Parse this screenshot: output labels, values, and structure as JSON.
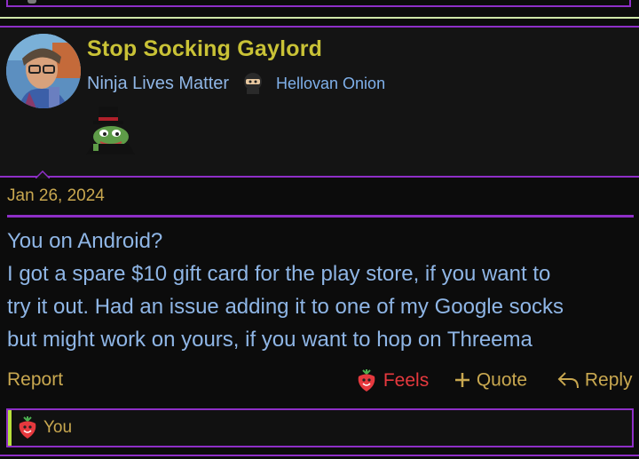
{
  "post": {
    "username": "Stop Socking Gaylord",
    "user_title": "Ninja Lives Matter",
    "user_banner": "Hellovan Onion",
    "date": "Jan 26, 2024",
    "message_lines": [
      "You on Android?",
      "I got a spare $10 gift card for the play store, if you want to",
      "try it out. Had an issue adding it to one of my Google socks",
      "but might work on yours, if you want to hop on Threema"
    ]
  },
  "actions": {
    "report": "Report",
    "feels": "Feels",
    "quote": "Quote",
    "reply": "Reply"
  },
  "reactions": {
    "who": "You"
  },
  "colors": {
    "accent_purple": "#8e2fc7",
    "username": "#c9c236",
    "link_gold": "#c9a850",
    "text_blue": "#8fb6e6",
    "reaction_red": "#e6393e"
  },
  "icons": {
    "ninja": "ninja-icon",
    "pepe": "pepe-hat-icon",
    "strawberry": "strawberry-icon",
    "plus": "plus-icon",
    "reply": "reply-arrow-icon"
  }
}
